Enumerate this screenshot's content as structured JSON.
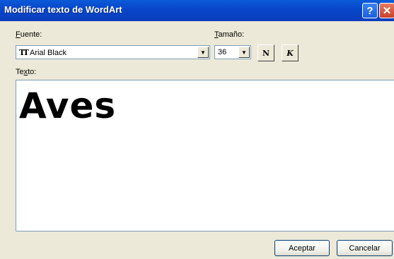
{
  "window": {
    "title": "Modificar texto de WordArt"
  },
  "titlebar": {
    "help_glyph": "?",
    "close_glyph": "✕"
  },
  "font": {
    "label_prefix": "",
    "label_mnemonic": "F",
    "label_rest": "uente:",
    "value": "Arial Black",
    "icon": "truetype-font-icon"
  },
  "size": {
    "label_mnemonic": "T",
    "label_rest": "amaño:",
    "value": "36"
  },
  "format": {
    "bold_glyph": "N",
    "italic_glyph": "K"
  },
  "text": {
    "label_prefix": "Te",
    "label_mnemonic": "x",
    "label_rest": "to:",
    "content": "Aves"
  },
  "buttons": {
    "ok": "Aceptar",
    "cancel": "Cancelar"
  },
  "colors": {
    "titlebar": "#0845c8",
    "dialog": "#ece9d8",
    "field_border": "#7f9db9"
  }
}
